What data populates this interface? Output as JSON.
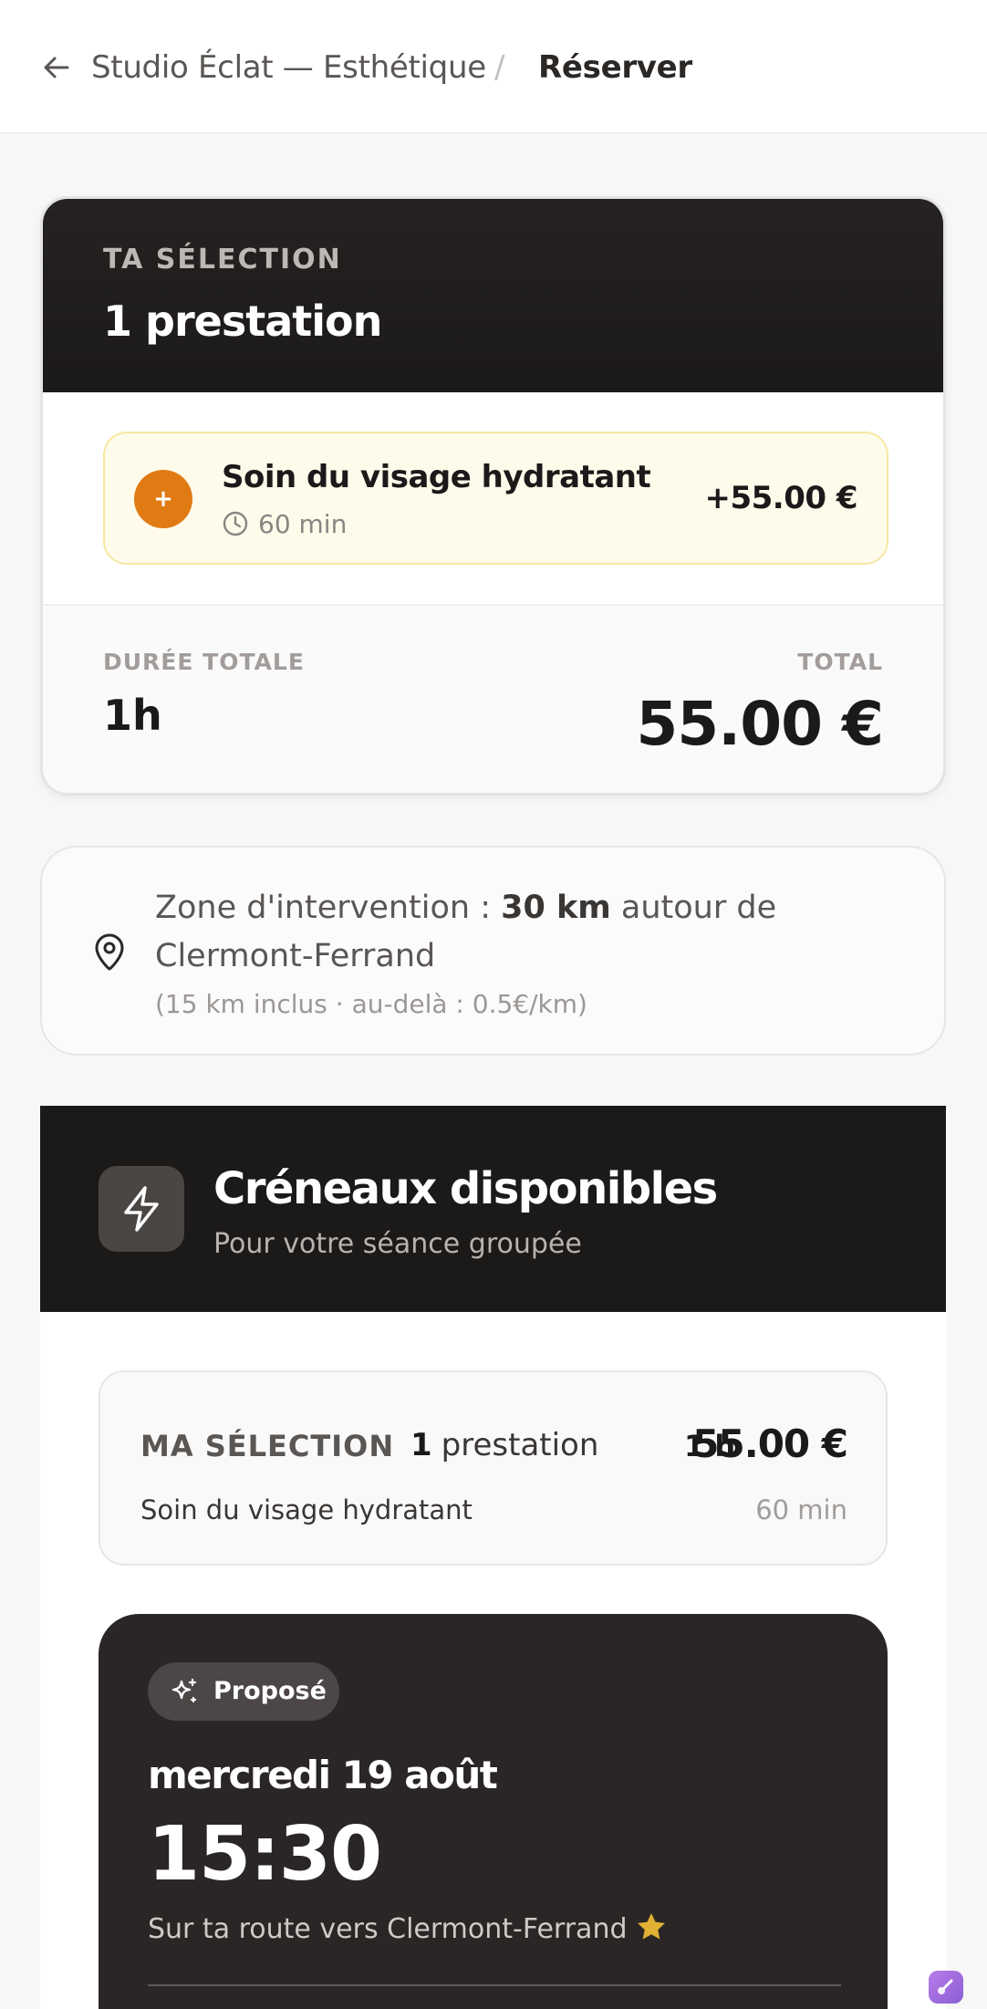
{
  "header": {
    "shop_name": "Studio Éclat — Esthétique",
    "separator": "/",
    "current_page": "Réserver"
  },
  "selection": {
    "eyebrow": "TA SÉLECTION",
    "title": "1 prestation",
    "service": {
      "badge": "+",
      "name": "Soin du visage hydratant",
      "duration": "60 min",
      "price": "+55.00 €"
    },
    "duration_label": "DURÉE TOTALE",
    "duration_value": "1h",
    "total_label": "TOTAL",
    "total_value": "55.00 €"
  },
  "zone": {
    "prefix": "Zone d'intervention : ",
    "distance": "30 km",
    "suffix": " autour de Clermont-Ferrand",
    "note": "(15 km inclus · au-delà : 0.5€/km)"
  },
  "slots": {
    "title": "Créneaux disponibles",
    "subtitle": "Pour votre séance groupée",
    "my_selection": {
      "label": "MA SÉLECTION",
      "count": "1",
      "count_label": "prestation",
      "duration": "1 h",
      "price": "55.00 €",
      "item_name": "Soin du visage hydratant",
      "item_duration": "60 min"
    },
    "proposed": {
      "badge": "Proposé",
      "date": "mercredi 19 août",
      "time": "15:30",
      "route": "Sur ta route vers Clermont-Ferrand"
    }
  },
  "colors": {
    "accent_orange": "#e07b14",
    "service_bg": "#fefbea",
    "dark_header": "#1c1a19",
    "slot_card": "#2b2626",
    "star": "#e0b132"
  },
  "icons": [
    "back-arrow-icon",
    "clock-icon",
    "map-pin-icon",
    "lightning-bolt-icon",
    "sparkles-icon",
    "star-icon",
    "widget-icon"
  ]
}
